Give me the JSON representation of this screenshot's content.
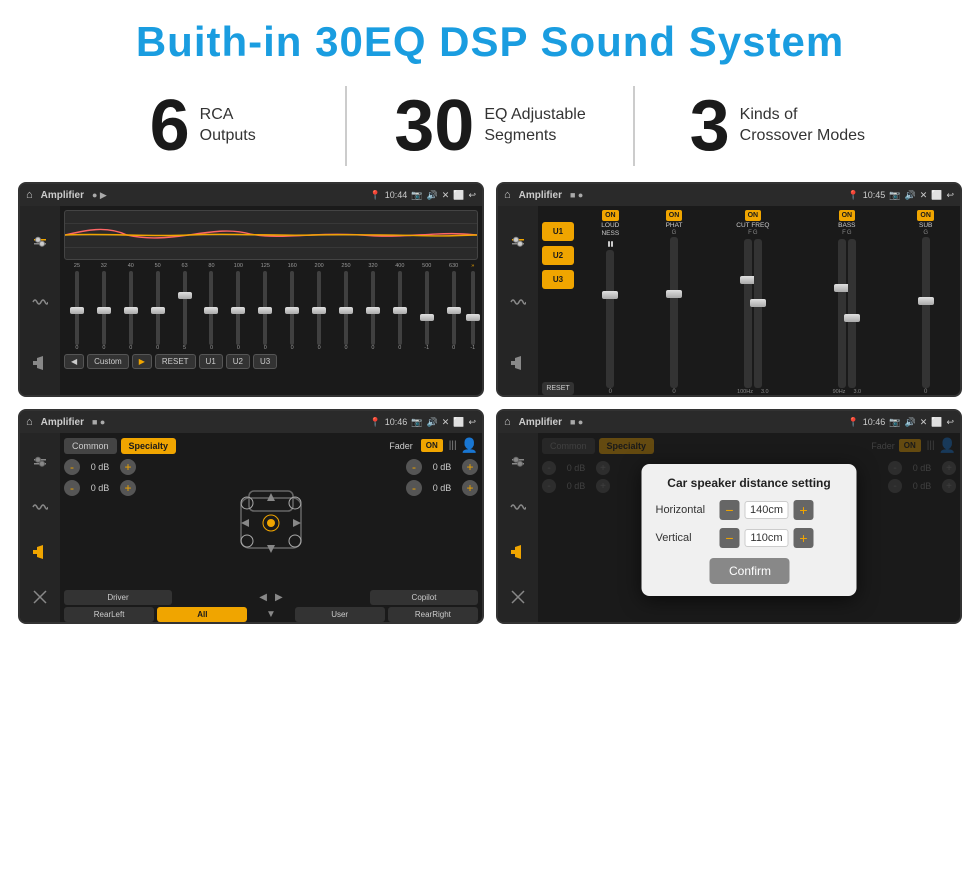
{
  "page": {
    "title": "Buith-in 30EQ DSP Sound System",
    "background": "#ffffff"
  },
  "stats": [
    {
      "number": "6",
      "label": "RCA\nOutputs"
    },
    {
      "number": "30",
      "label": "EQ Adjustable\nSegments"
    },
    {
      "number": "3",
      "label": "Kinds of\nCrossover Modes"
    }
  ],
  "screens": [
    {
      "id": "screen-eq",
      "topbar": {
        "home": "⌂",
        "title": "Amplifier",
        "time": "10:44"
      },
      "type": "eq"
    },
    {
      "id": "screen-amp",
      "topbar": {
        "home": "⌂",
        "title": "Amplifier",
        "time": "10:45"
      },
      "type": "amp"
    },
    {
      "id": "screen-fader",
      "topbar": {
        "home": "⌂",
        "title": "Amplifier",
        "time": "10:46"
      },
      "type": "fader"
    },
    {
      "id": "screen-distance",
      "topbar": {
        "home": "⌂",
        "title": "Amplifier",
        "time": "10:46"
      },
      "type": "distance"
    }
  ],
  "eq": {
    "frequencies": [
      "25",
      "32",
      "40",
      "50",
      "63",
      "80",
      "100",
      "125",
      "160",
      "200",
      "250",
      "320",
      "400",
      "500",
      "630"
    ],
    "values": [
      "0",
      "0",
      "0",
      "0",
      "5",
      "0",
      "0",
      "0",
      "0",
      "0",
      "0",
      "0",
      "0",
      "-1",
      "0",
      "-1"
    ],
    "thumb_positions": [
      50,
      45,
      48,
      50,
      35,
      50,
      50,
      50,
      50,
      50,
      50,
      50,
      50,
      60,
      50,
      60
    ],
    "bottom_buttons": [
      "◀",
      "Custom",
      "▶",
      "RESET",
      "U1",
      "U2",
      "U3"
    ]
  },
  "amp_screen": {
    "presets": [
      "U1",
      "U2",
      "U3"
    ],
    "channels": [
      {
        "on_label": "ON",
        "name": "LOUDNESS",
        "on": true
      },
      {
        "on_label": "ON",
        "name": "PHAT",
        "on": true
      },
      {
        "on_label": "ON",
        "name": "CUT FREQ",
        "on": true
      },
      {
        "on_label": "ON",
        "name": "BASS",
        "on": true
      },
      {
        "on_label": "ON",
        "name": "SUB",
        "on": true
      }
    ],
    "reset_label": "RESET"
  },
  "fader_screen": {
    "tabs": [
      "Common",
      "Specialty"
    ],
    "active_tab": "Specialty",
    "fader_label": "Fader",
    "on_label": "ON",
    "db_values": [
      "0 dB",
      "0 dB",
      "0 dB",
      "0 dB"
    ],
    "buttons": [
      "Driver",
      "RearLeft",
      "All",
      "User",
      "RearRight",
      "Copilot"
    ]
  },
  "distance_dialog": {
    "title": "Car speaker distance setting",
    "horizontal_label": "Horizontal",
    "horizontal_value": "140cm",
    "vertical_label": "Vertical",
    "vertical_value": "110cm",
    "confirm_label": "Confirm"
  }
}
